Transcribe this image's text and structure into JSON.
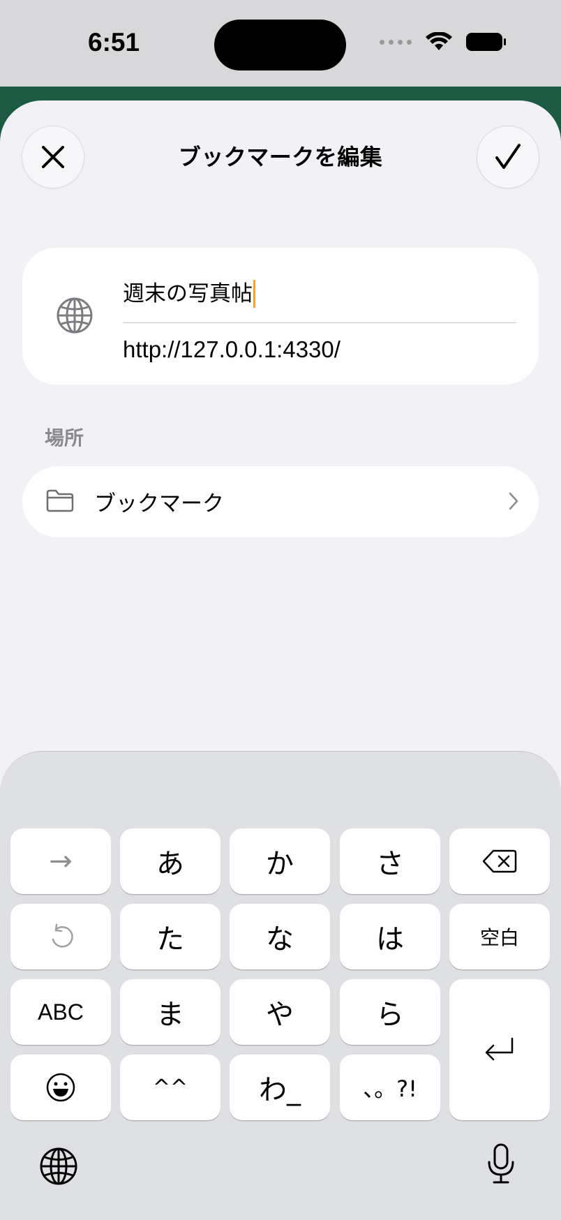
{
  "status_bar": {
    "time": "6:51"
  },
  "header": {
    "title": "ブックマークを編集",
    "close_icon": "close-icon",
    "done_icon": "checkmark-icon"
  },
  "bookmark": {
    "icon": "globe-icon",
    "title_value": "週末の写真帖",
    "url_value": "http://127.0.0.1:4330/"
  },
  "location": {
    "section_label": "場所",
    "folder_icon": "folder-icon",
    "folder_name": "ブックマーク"
  },
  "keyboard": {
    "rows": [
      [
        "→",
        "あ",
        "か",
        "さ",
        "⌫"
      ],
      [
        "↺",
        "た",
        "な",
        "は",
        "空白"
      ],
      [
        "ABC",
        "ま",
        "や",
        "ら",
        "⏎"
      ],
      [
        "😀",
        "^^",
        "わ_",
        "、。?!"
      ]
    ],
    "keys": {
      "next": "→",
      "a": "あ",
      "ka": "か",
      "sa": "さ",
      "undo": "↺",
      "ta": "た",
      "na": "な",
      "ha": "は",
      "space": "空白",
      "abc": "ABC",
      "ma": "ま",
      "ya": "や",
      "ra": "ら",
      "emoticon": "^^",
      "wa": "わ_",
      "punct": "、。?!"
    }
  },
  "colors": {
    "accent_caret": "#f5a623",
    "background_strip": "#1d5a43",
    "sheet": "#f2f2f6"
  }
}
